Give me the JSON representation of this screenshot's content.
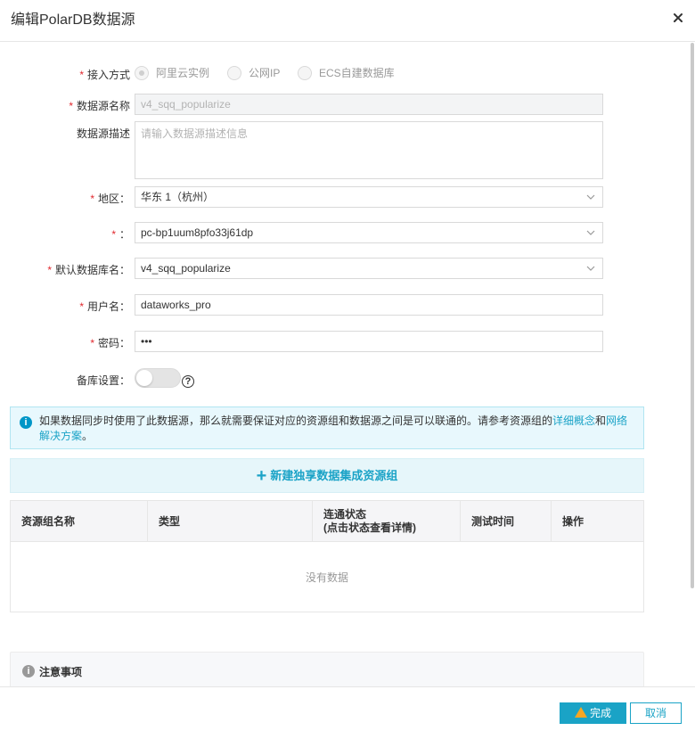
{
  "dialog": {
    "title": "编辑PolarDB数据源",
    "close_icon": "close-icon"
  },
  "form": {
    "access_mode": {
      "label": "接入方式",
      "options": [
        "阿里云实例",
        "公网IP",
        "ECS自建数据库"
      ],
      "selected": "阿里云实例"
    },
    "name": {
      "label": "数据源名称",
      "value": "v4_sqq_popularize"
    },
    "description": {
      "label": "数据源描述",
      "placeholder": "请输入数据源描述信息"
    },
    "region": {
      "label": "地区：",
      "value": "华东 1（杭州）"
    },
    "cluster": {
      "label": "：",
      "value": "pc-bp1uum8pfo33j61dp"
    },
    "default_db": {
      "label": "默认数据库名：",
      "value": "v4_sqq_popularize"
    },
    "username": {
      "label": "用户名：",
      "value": "dataworks_pro"
    },
    "password": {
      "label": "密码：",
      "value": "•••"
    },
    "backup": {
      "label": "备库设置：",
      "help": "?",
      "enabled": false
    }
  },
  "info": {
    "icon": "info-icon",
    "text_before": "如果数据同步时使用了此数据源，那么就需要保证对应的资源组和数据源之间是可以联通的。请参考资源组的",
    "link1": "详细概念",
    "text_middle": "和",
    "link2": "网络解决方案",
    "text_after": "。"
  },
  "new_group": {
    "icon": "+",
    "label": "新建独享数据集成资源组"
  },
  "table": {
    "columns": [
      "资源组名称",
      "类型",
      "连通状态\n(点击状态查看详情)",
      "测试时间",
      "操作"
    ],
    "col1": "资源组名称",
    "col2": "类型",
    "col3_line1": "连通状态",
    "col3_line2": "(点击状态查看详情)",
    "col4": "测试时间",
    "col5": "操作",
    "empty": "没有数据"
  },
  "notice": {
    "icon": "i",
    "title": "注意事项"
  },
  "footer": {
    "ok": "完成",
    "cancel": "取消"
  },
  "colors": {
    "primary": "#1aa3c6",
    "required": "#e0282e",
    "info_bg": "#e8f8fd"
  }
}
